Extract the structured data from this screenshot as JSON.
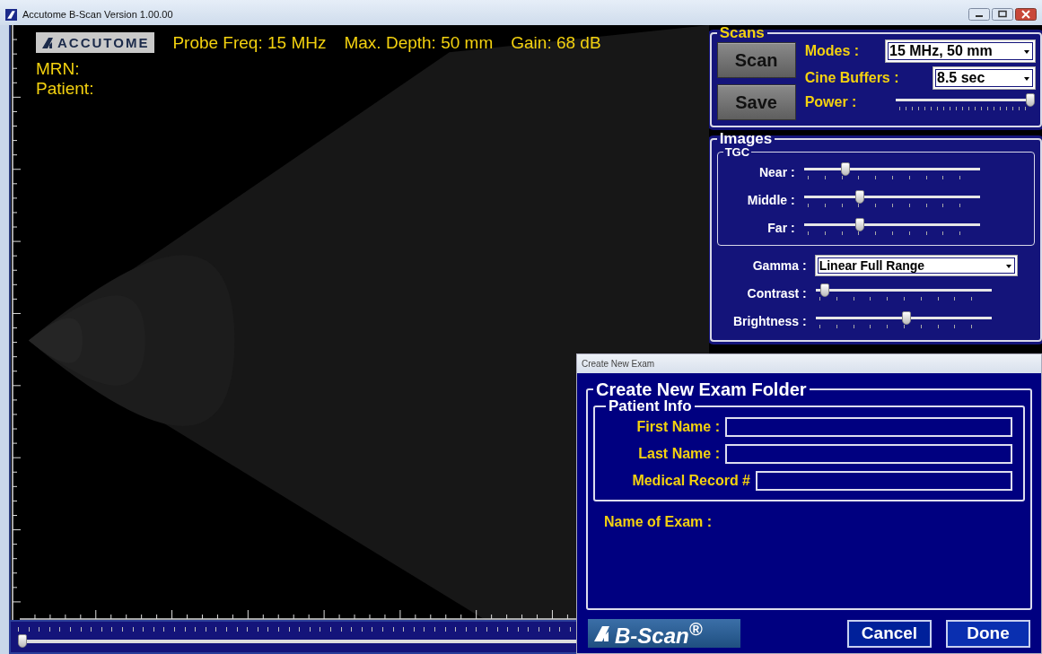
{
  "window": {
    "title": "Accutome B-Scan Version 1.00.00"
  },
  "scan_view": {
    "logo": "ACCUTOME",
    "probe_freq": "Probe Freq: 15 MHz",
    "max_depth": "Max. Depth: 50 mm",
    "gain": "Gain: 68 dB",
    "mrn": "MRN:",
    "patient": "Patient:",
    "frame_slider": {
      "level": 0
    }
  },
  "scans": {
    "title": "Scans",
    "buttons": [
      "Scan",
      "Save"
    ],
    "modes": {
      "label": "Modes :",
      "value": "15 MHz, 50 mm"
    },
    "cine_buffers": {
      "label": "Cine Buffers :",
      "value": "8.5 sec"
    },
    "power": {
      "label": "Power :",
      "level": 1
    }
  },
  "images": {
    "title": "Images",
    "tgc": {
      "title": "TGC",
      "sliders": [
        {
          "label": "Near :",
          "level": 0.22
        },
        {
          "label": "Middle :",
          "level": 0.31
        },
        {
          "label": "Far :",
          "level": 0.31
        }
      ]
    },
    "gamma": {
      "label": "Gamma :",
      "value": "Linear Full Range"
    },
    "sliders": [
      {
        "label": "Contrast :",
        "level": 0.03
      },
      {
        "label": "Brightness :",
        "level": 0.52
      }
    ]
  },
  "dialog": {
    "title": "Create New Exam",
    "group_title": "Create New Exam Folder",
    "patient_info": {
      "title": "Patient Info",
      "fields": [
        {
          "label": "First Name :"
        },
        {
          "label": "Last Name :"
        },
        {
          "label": "Medical Record #"
        }
      ]
    },
    "exam_name_label": "Name of Exam :",
    "logo": "B-Scan$^{®}$",
    "buttons": [
      "Cancel",
      "Done"
    ]
  }
}
